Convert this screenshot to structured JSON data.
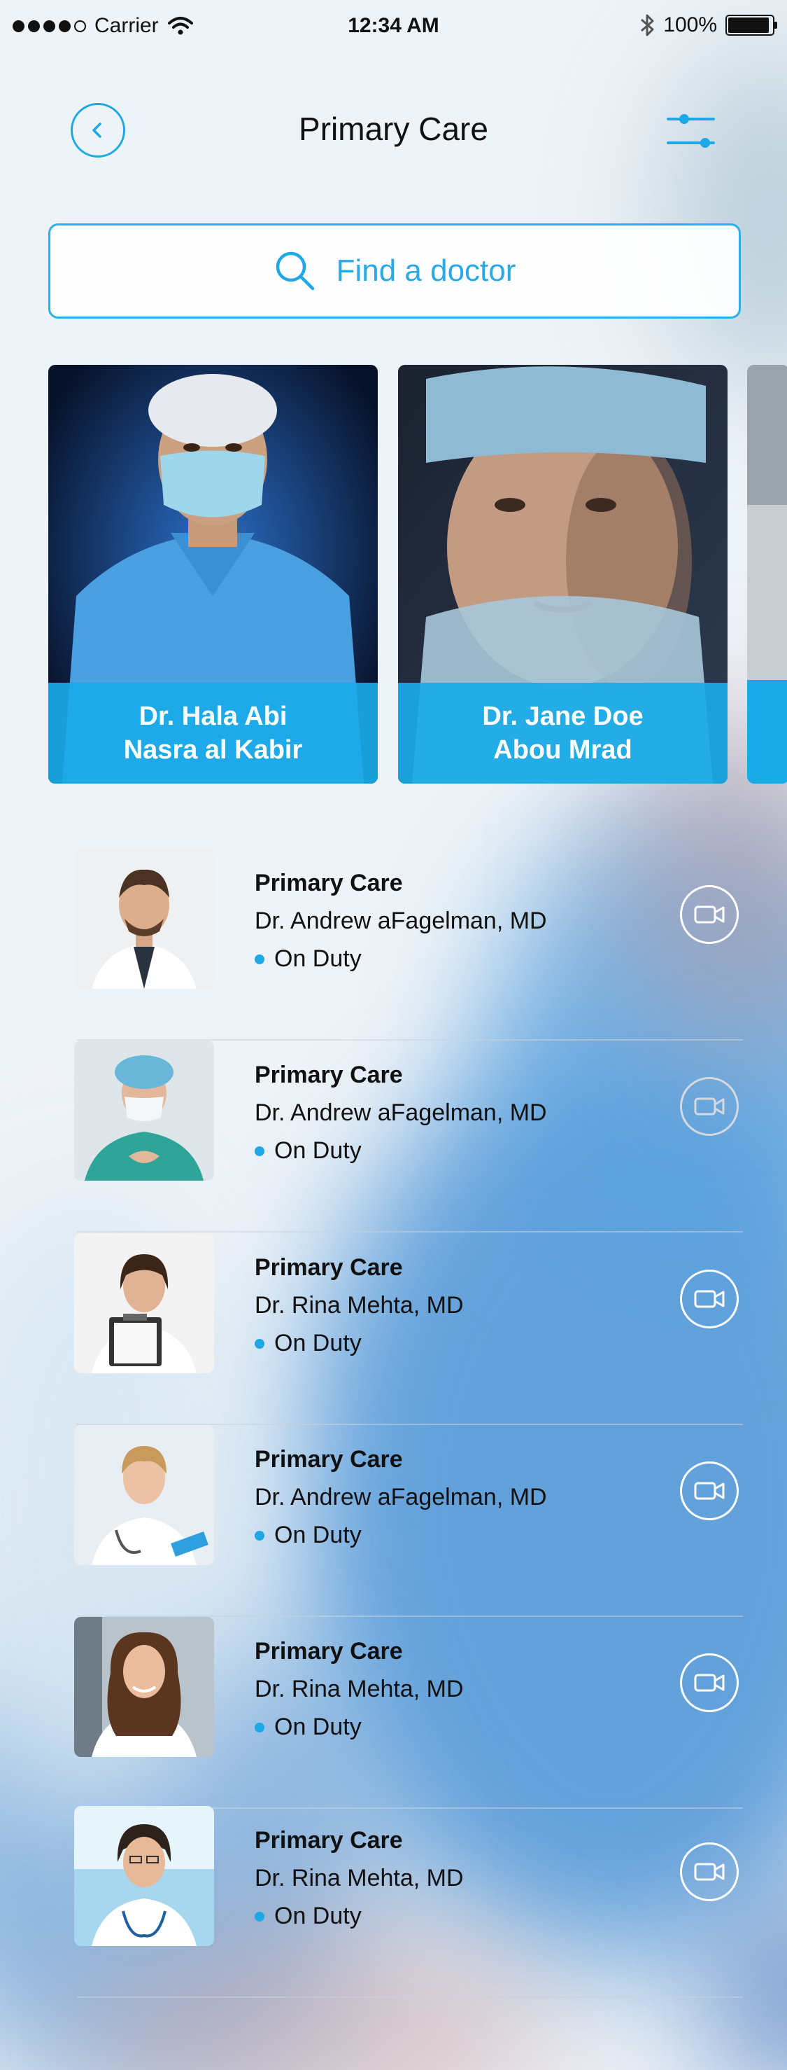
{
  "status_bar": {
    "carrier": "Carrier",
    "time": "12:34 AM",
    "battery": "100%"
  },
  "header": {
    "title": "Primary Care",
    "back_icon": "chevron-left-icon",
    "filter_icon": "sliders-icon"
  },
  "search": {
    "placeholder": "Find a doctor",
    "icon": "search-icon"
  },
  "featured": [
    {
      "name": "Dr. Hala Abi\nNasra al Kabir"
    },
    {
      "name": "Dr. Jane Doe\nAbou Mrad"
    }
  ],
  "doctors": [
    {
      "specialty": "Primary Care",
      "name": "Dr. Andrew aFagelman, MD",
      "status": "On Duty"
    },
    {
      "specialty": "Primary Care",
      "name": "Dr. Andrew aFagelman, MD",
      "status": "On Duty"
    },
    {
      "specialty": "Primary Care",
      "name": "Dr. Rina Mehta, MD",
      "status": "On Duty"
    },
    {
      "specialty": "Primary Care",
      "name": "Dr. Andrew aFagelman, MD",
      "status": "On Duty"
    },
    {
      "specialty": "Primary Care",
      "name": "Dr. Rina Mehta, MD",
      "status": "On Duty"
    },
    {
      "specialty": "Primary Care",
      "name": "Dr. Rina Mehta, MD",
      "status": "On Duty"
    }
  ],
  "colors": {
    "accent": "#1fa8e6",
    "card_label": "#1aaae8",
    "status_dot": "#1fa8e6"
  }
}
